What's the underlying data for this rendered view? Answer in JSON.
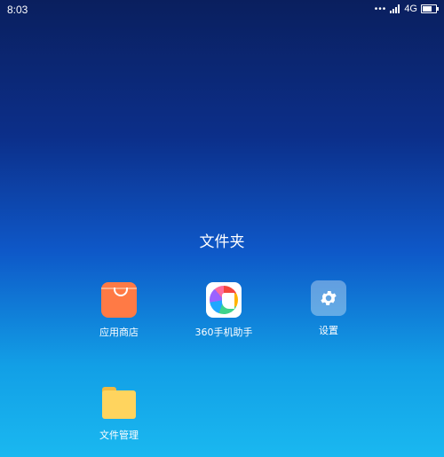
{
  "status_bar": {
    "time": "8:03",
    "dots": "•••",
    "network": "4G",
    "battery_level": 0.7
  },
  "folder": {
    "title": "文件夹"
  },
  "apps": [
    {
      "label": "应用商店",
      "icon": "shopping-bag-icon",
      "color": "#ff7a45"
    },
    {
      "label": "360手机助手",
      "icon": "assistant-360-icon"
    },
    {
      "label": "设置",
      "icon": "gear-icon"
    },
    {
      "label": "文件管理",
      "icon": "folder-icon",
      "color": "#ffd45e"
    }
  ]
}
